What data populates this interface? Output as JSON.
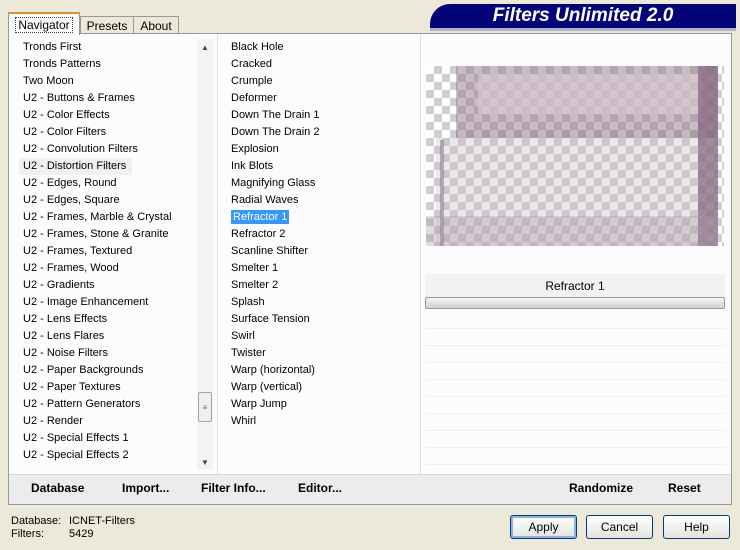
{
  "tabs": [
    {
      "label": "Navigator",
      "active": true
    },
    {
      "label": "Presets",
      "active": false
    },
    {
      "label": "About",
      "active": false
    }
  ],
  "banner": {
    "title": "Filters Unlimited 2.0"
  },
  "categories": {
    "items": [
      "Tronds First",
      "Tronds Patterns",
      "Two Moon",
      "U2 - Buttons & Frames",
      "U2 - Color Effects",
      "U2 - Color Filters",
      "U2 - Convolution Filters",
      "U2 - Distortion Filters",
      "U2 - Edges, Round",
      "U2 - Edges, Square",
      "U2 - Frames, Marble & Crystal",
      "U2 - Frames, Stone & Granite",
      "U2 - Frames, Textured",
      "U2 - Frames, Wood",
      "U2 - Gradients",
      "U2 - Image Enhancement",
      "U2 - Lens Effects",
      "U2 - Lens Flares",
      "U2 - Noise Filters",
      "U2 - Paper Backgrounds",
      "U2 - Paper Textures",
      "U2 - Pattern Generators",
      "U2 - Render",
      "U2 - Special Effects 1",
      "U2 - Special Effects 2"
    ],
    "highlighted": "U2 - Distortion Filters"
  },
  "filters": {
    "items": [
      "Black Hole",
      "Cracked",
      "Crumple",
      "Deformer",
      "Down The Drain 1",
      "Down The Drain 2",
      "Explosion",
      "Ink Blots",
      "Magnifying Glass",
      "Radial Waves",
      "Refractor 1",
      "Refractor 2",
      "Scanline Shifter",
      "Smelter 1",
      "Smelter 2",
      "Splash",
      "Surface Tension",
      "Swirl",
      "Twister",
      "Warp (horizontal)",
      "Warp (vertical)",
      "Warp Jump",
      "Whirl"
    ],
    "selected": "Refractor 1"
  },
  "preview": {
    "filter_name": "Refractor 1"
  },
  "toolbar": {
    "database": "Database",
    "import": "Import...",
    "filter_info": "Filter Info...",
    "editor": "Editor...",
    "randomize": "Randomize",
    "reset": "Reset"
  },
  "info": {
    "database_label": "Database:",
    "database_value": "ICNET-Filters",
    "filters_label": "Filters:",
    "filters_value": "5429"
  },
  "buttons": {
    "apply": "Apply",
    "cancel": "Cancel",
    "help": "Help"
  },
  "colors": {
    "banner": "#04047a",
    "selection": "#3399ff",
    "preview_tint": "#9c8296"
  }
}
